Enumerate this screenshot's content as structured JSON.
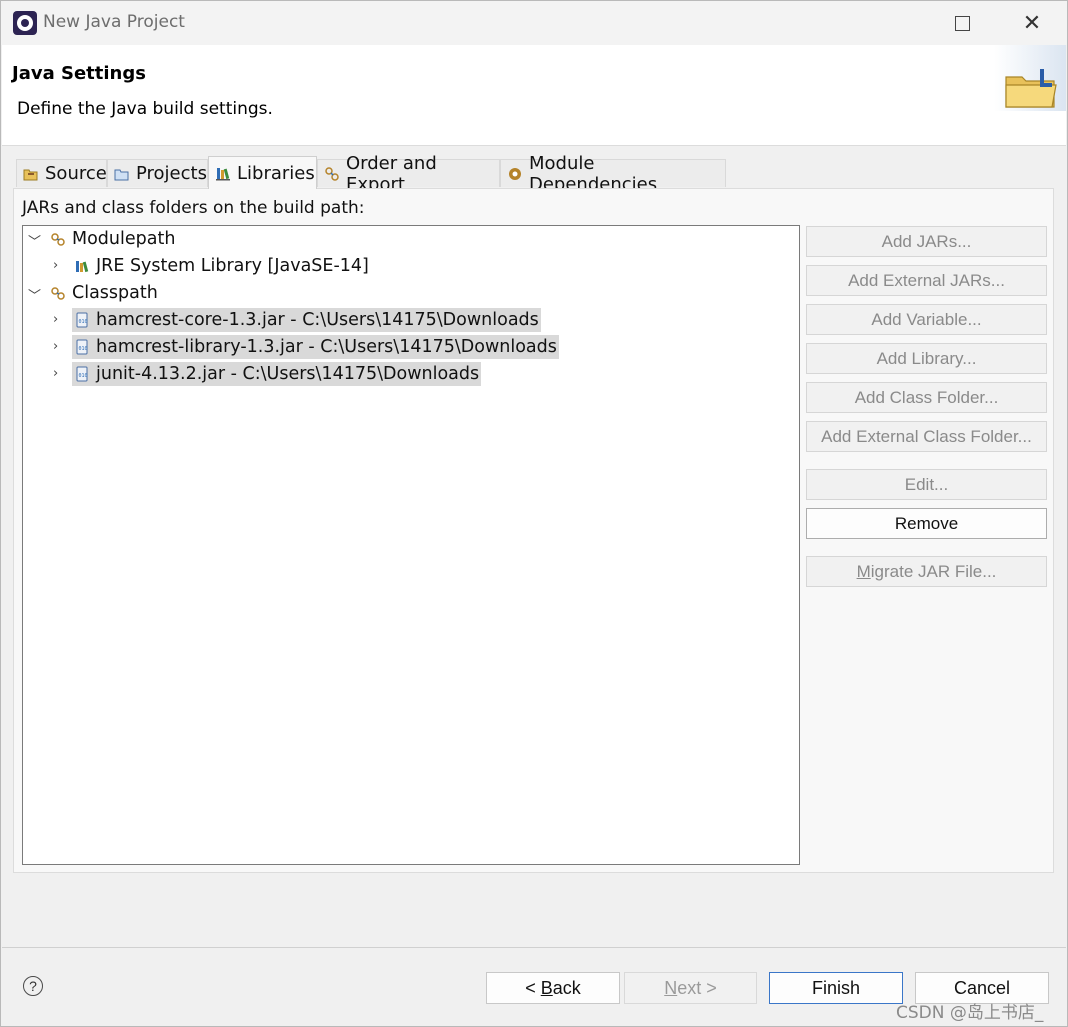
{
  "window": {
    "title": "New Java Project"
  },
  "header": {
    "title": "Java Settings",
    "subtitle": "Define the Java build settings."
  },
  "tabs": [
    {
      "label": "Source",
      "icon": "source-folder-icon"
    },
    {
      "label": "Projects",
      "icon": "projects-folder-icon"
    },
    {
      "label": "Libraries",
      "icon": "libraries-icon",
      "active": true
    },
    {
      "label": "Order and Export",
      "icon": "order-export-icon"
    },
    {
      "label": "Module Dependencies",
      "icon": "module-icon"
    }
  ],
  "libraries": {
    "section_label": "JARs and class folders on the build path:",
    "tree": {
      "modulepath": {
        "label": "Modulepath",
        "children": [
          {
            "label": "JRE System Library [JavaSE-14]"
          }
        ]
      },
      "classpath": {
        "label": "Classpath",
        "children": [
          {
            "label": "hamcrest-core-1.3.jar - C:\\Users\\14175\\Downloads"
          },
          {
            "label": "hamcrest-library-1.3.jar - C:\\Users\\14175\\Downloads"
          },
          {
            "label": "junit-4.13.2.jar - C:\\Users\\14175\\Downloads"
          }
        ]
      }
    },
    "buttons": {
      "add_jars": "Add JARs...",
      "add_external_jars": "Add External JARs...",
      "add_variable": "Add Variable...",
      "add_library": "Add Library...",
      "add_class_folder": "Add Class Folder...",
      "add_external_class_folder": "Add External Class Folder...",
      "edit": "Edit...",
      "remove": "Remove",
      "migrate_jar_prefix": "M",
      "migrate_jar_rest": "igrate JAR File..."
    }
  },
  "footer": {
    "help_glyph": "?",
    "back_prefix": "< ",
    "back_mnemonic": "B",
    "back_rest": "ack",
    "next_mnemonic": "N",
    "next_rest": "ext >",
    "finish": "Finish",
    "cancel": "Cancel"
  },
  "watermark": "CSDN @岛上书店_",
  "colors": {
    "accent": "#3a76c8",
    "selection": "#d9d9d9",
    "disabled_text": "#8a8a8a"
  }
}
